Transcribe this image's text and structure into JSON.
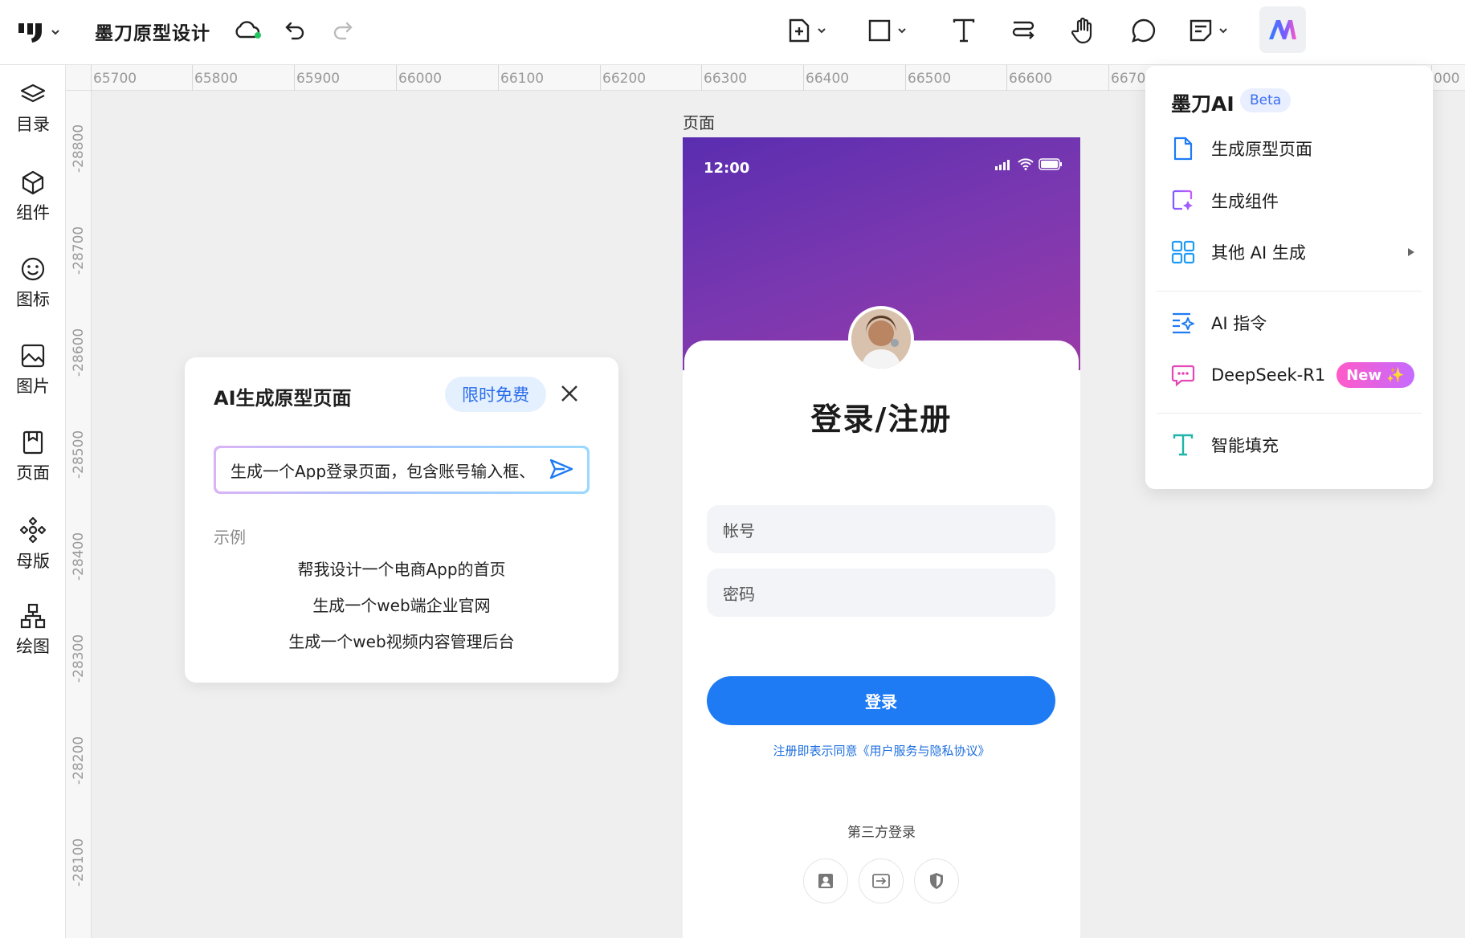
{
  "toolbar": {
    "doc_title": "墨刀原型设计",
    "ai_active_color": "#eaf2ff"
  },
  "sidebar": {
    "items": [
      {
        "label": "目录",
        "icon": "layers-icon"
      },
      {
        "label": "组件",
        "icon": "cube-icon"
      },
      {
        "label": "图标",
        "icon": "smiley-icon"
      },
      {
        "label": "图片",
        "icon": "image-icon"
      },
      {
        "label": "页面",
        "icon": "bookmark-page-icon"
      },
      {
        "label": "母版",
        "icon": "master-icon"
      },
      {
        "label": "绘图",
        "icon": "diagram-icon"
      }
    ]
  },
  "ruler": {
    "h_ticks": [
      "65700",
      "65800",
      "65900",
      "66000",
      "66100",
      "66200",
      "66300",
      "66400",
      "66500",
      "66600",
      "6670",
      "000"
    ],
    "v_ticks": [
      "-28800",
      "-28700",
      "-28600",
      "-28500",
      "-28400",
      "-28300",
      "-28200",
      "-28100"
    ]
  },
  "ai_panel": {
    "title": "AI生成原型页面",
    "badge": "限时免费",
    "input_value": "生成一个App登录页面，包含账号输入框、",
    "examples_label": "示例",
    "examples": [
      "帮我设计一个电商App的首页",
      "生成一个web端企业官网",
      "生成一个web视频内容管理后台"
    ]
  },
  "canvas": {
    "page_label": "页面"
  },
  "phone": {
    "time": "12:00",
    "title": "登录/注册",
    "account_placeholder": "帐号",
    "password_placeholder": "密码",
    "login_button": "登录",
    "agreement": "注册即表示同意《用户服务与隐私协议》",
    "third_party_title": "第三方登录",
    "header_gradient": [
      "#5a2db0",
      "#9a3aa8"
    ],
    "button_color": "#1e7bf4"
  },
  "ai_menu": {
    "title": "墨刀AI",
    "beta": "Beta",
    "items": [
      {
        "label": "生成原型页面",
        "icon": "document-icon"
      },
      {
        "label": "生成组件",
        "icon": "component-sparkle-icon"
      },
      {
        "label": "其他 AI 生成",
        "icon": "grid-icon"
      },
      {
        "label": "AI 指令",
        "icon": "ai-command-icon"
      },
      {
        "label": "DeepSeek-R1",
        "icon": "chat-bot-icon",
        "badge": "New ✨"
      },
      {
        "label": "智能填充",
        "icon": "text-fill-icon"
      }
    ]
  }
}
